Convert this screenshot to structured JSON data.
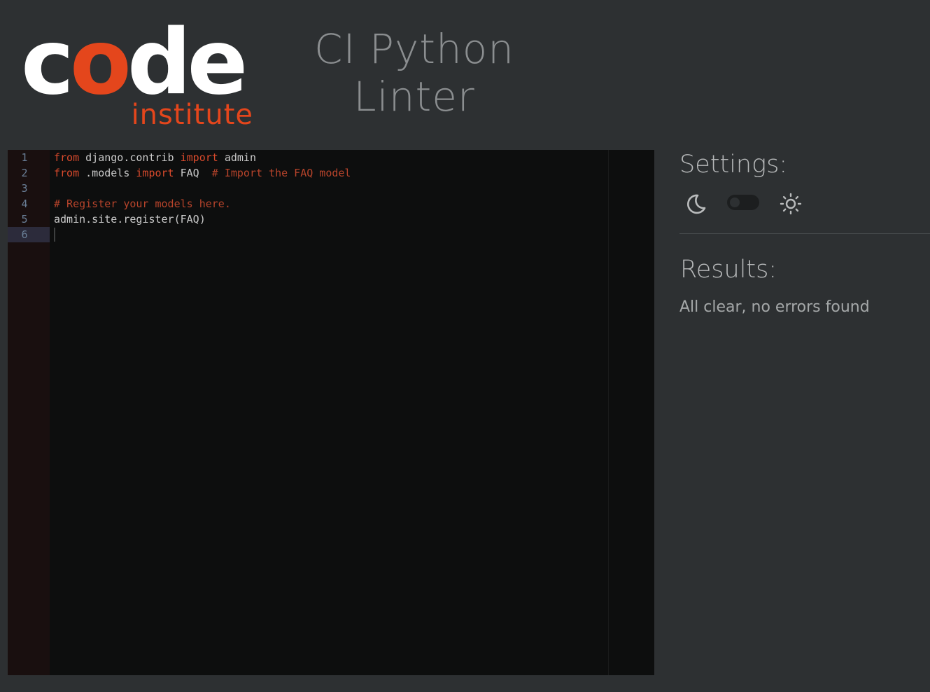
{
  "logo": {
    "word_start": "c",
    "word_accent": "o",
    "word_end": "de",
    "sub": "institute"
  },
  "header": {
    "title_line1": "CI Python",
    "title_line2": "Linter"
  },
  "editor": {
    "line_numbers": [
      "1",
      "2",
      "3",
      "4",
      "5",
      "6"
    ],
    "active_line": 6,
    "lines": [
      [
        {
          "t": "from",
          "c": "kw"
        },
        {
          "t": " django.contrib ",
          "c": ""
        },
        {
          "t": "import",
          "c": "kw"
        },
        {
          "t": " admin",
          "c": ""
        }
      ],
      [
        {
          "t": "from",
          "c": "kw"
        },
        {
          "t": " .models ",
          "c": ""
        },
        {
          "t": "import",
          "c": "kw"
        },
        {
          "t": " FAQ  ",
          "c": ""
        },
        {
          "t": "# Import the FAQ model",
          "c": "cm"
        }
      ],
      [],
      [
        {
          "t": "# Register your models here.",
          "c": "cm"
        }
      ],
      [
        {
          "t": "admin.site.register(FAQ)",
          "c": ""
        }
      ],
      []
    ]
  },
  "settings": {
    "heading": "Settings:",
    "dark_icon": "moon-icon",
    "light_icon": "sun-icon",
    "theme": "dark"
  },
  "results": {
    "heading": "Results:",
    "message": "All clear, no errors found"
  },
  "colors": {
    "accent": "#e4461c",
    "background": "#2d3032",
    "editor_background": "#0d0e0e",
    "keyword": "#d94a2c"
  }
}
